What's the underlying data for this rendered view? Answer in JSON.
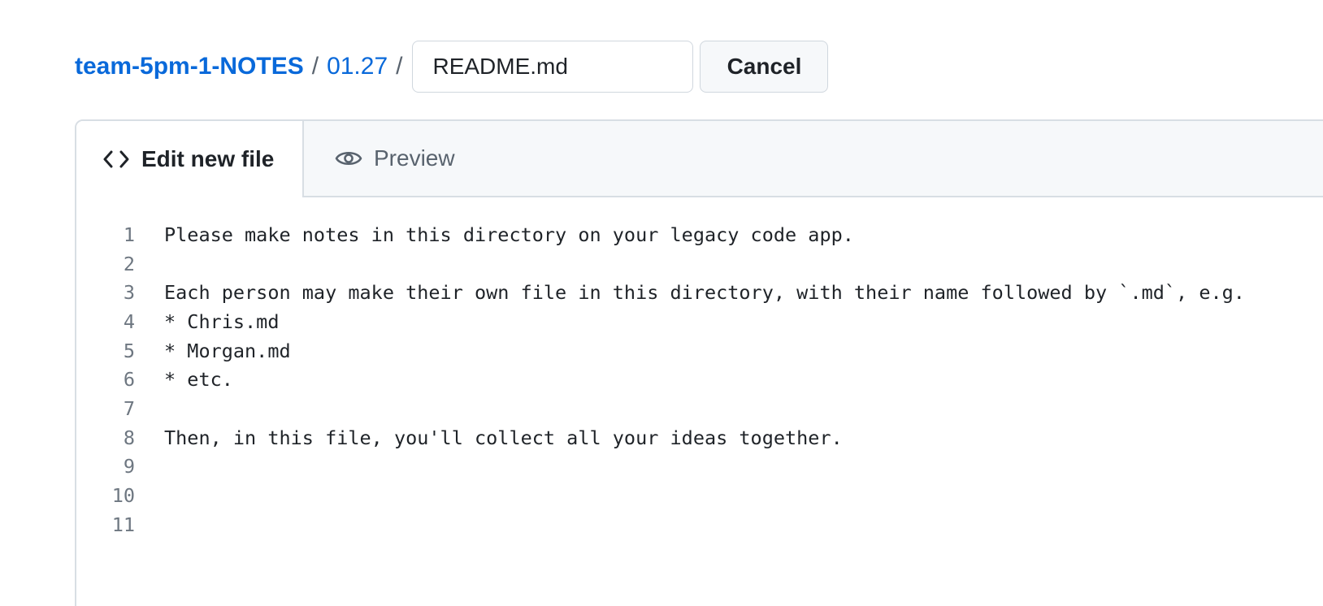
{
  "breadcrumb": {
    "repo": "team-5pm-1-NOTES",
    "separator": "/",
    "folder": "01.27"
  },
  "filename_input": {
    "value": "README.md"
  },
  "cancel_button": {
    "label": "Cancel"
  },
  "tabs": [
    {
      "label": "Edit new file",
      "icon": "code-icon",
      "active": true
    },
    {
      "label": "Preview",
      "icon": "eye-icon",
      "active": false
    }
  ],
  "editor": {
    "lines": [
      {
        "number": "1",
        "text": "Please make notes in this directory on your legacy code app."
      },
      {
        "number": "2",
        "text": ""
      },
      {
        "number": "3",
        "text": "Each person may make their own file in this directory, with their name followed by `.md`, e.g."
      },
      {
        "number": "4",
        "text": "* Chris.md"
      },
      {
        "number": "5",
        "text": "* Morgan.md"
      },
      {
        "number": "6",
        "text": "* etc."
      },
      {
        "number": "7",
        "text": ""
      },
      {
        "number": "8",
        "text": "Then, in this file, you'll collect all your ideas together."
      },
      {
        "number": "9",
        "text": ""
      },
      {
        "number": "10",
        "text": ""
      },
      {
        "number": "11",
        "text": ""
      }
    ]
  },
  "colors": {
    "link": "#0969da",
    "border": "#d8dee4",
    "tab_bg": "#f6f8fa",
    "muted": "#59636e"
  }
}
